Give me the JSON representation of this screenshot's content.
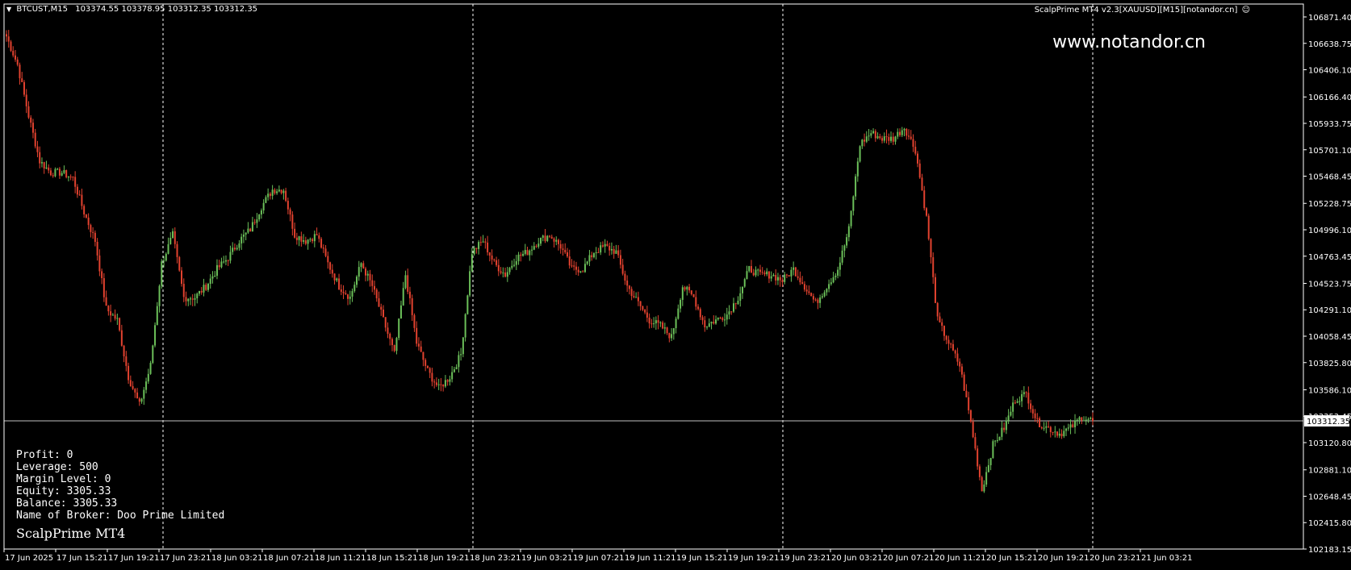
{
  "header": {
    "symbol": "BTCUST,M15",
    "ohlc": "103374.55 103378.95 103312.35 103312.35"
  },
  "indicator_label": "ScalpPrime MT4 v2.3[XAUUSD][M15][notandor.cn]",
  "watermark": "www.notandor.cn",
  "account": {
    "profit": "Profit: 0",
    "leverage": "Leverage: 500",
    "margin_level": "Margin Level: 0",
    "equity": "Equity: 3305.33",
    "balance": "Balance: 3305.33",
    "broker": "Name of Broker: Doo Prime Limited"
  },
  "brand": "ScalpPrime MT4",
  "colors": {
    "background": "#000000",
    "up": "#6bbf59",
    "down": "#e2422f",
    "axis": "#ffffff",
    "grid": "#ffffff",
    "price_line": "#c0c0c0"
  },
  "chart_data": {
    "type": "candlestick",
    "timeframe": "M15",
    "current_price": "103312.35",
    "y_ticks": [
      "106871.40",
      "106638.75",
      "106406.10",
      "106166.40",
      "105933.75",
      "105701.10",
      "105468.45",
      "105228.75",
      "104996.10",
      "104763.45",
      "104523.75",
      "104291.10",
      "104058.45",
      "103825.80",
      "103586.10",
      "103353.45",
      "103120.80",
      "102881.10",
      "102648.45",
      "102415.80",
      "102183.15"
    ],
    "x_ticks": [
      "17 Jun 2025",
      "17 Jun 15:21",
      "17 Jun 19:21",
      "17 Jun 23:21",
      "18 Jun 03:21",
      "18 Jun 07:21",
      "18 Jun 11:21",
      "18 Jun 15:21",
      "18 Jun 19:21",
      "18 Jun 23:21",
      "19 Jun 03:21",
      "19 Jun 07:21",
      "19 Jun 11:21",
      "19 Jun 15:21",
      "19 Jun 19:21",
      "19 Jun 23:21",
      "20 Jun 03:21",
      "20 Jun 07:21",
      "20 Jun 11:21",
      "20 Jun 15:21",
      "20 Jun 19:21",
      "20 Jun 23:21",
      "21 Jun 03:21"
    ],
    "ylim": [
      102183.15,
      106871.4
    ],
    "vertical_grid_at": [
      "17 Jun 23:21",
      "18 Jun 23:21",
      "19 Jun 23:21",
      "20 Jun 23:21"
    ],
    "close_anchors": [
      106700,
      106450,
      106000,
      105600,
      105500,
      105500,
      105450,
      105150,
      104900,
      104300,
      104200,
      103700,
      103450,
      103800,
      104700,
      104950,
      104400,
      104400,
      104500,
      104650,
      104750,
      104900,
      105000,
      105200,
      105350,
      105350,
      104950,
      104900,
      104950,
      104700,
      104500,
      104400,
      104700,
      104500,
      104200,
      103900,
      104600,
      104000,
      103750,
      103600,
      103700,
      103900,
      104800,
      104900,
      104700,
      104600,
      104750,
      104800,
      104900,
      104950,
      104850,
      104650,
      104650,
      104800,
      104850,
      104800,
      104500,
      104350,
      104200,
      104150,
      104050,
      104500,
      104400,
      104150,
      104200,
      104250,
      104400,
      104650,
      104600,
      104600,
      104550,
      104650,
      104500,
      104350,
      104500,
      104650,
      105000,
      105750,
      105850,
      105800,
      105800,
      105900,
      105700,
      105100,
      104200,
      104000,
      103800,
      103300,
      102700,
      103100,
      103250,
      103500,
      103550,
      103300,
      103250,
      103200,
      103250,
      103350,
      103312.35
    ]
  }
}
